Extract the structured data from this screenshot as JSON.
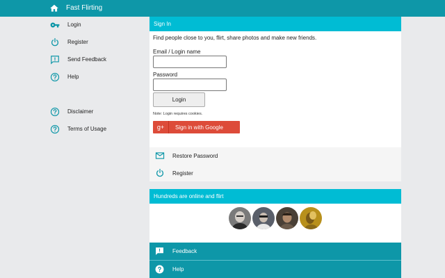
{
  "app": {
    "title": "Fast Flirting"
  },
  "sidebar": {
    "items": [
      {
        "label": "Login",
        "icon": "key-icon"
      },
      {
        "label": "Register",
        "icon": "power-icon"
      },
      {
        "label": "Send Feedback",
        "icon": "feedback-icon"
      },
      {
        "label": "Help",
        "icon": "help-icon"
      },
      {
        "label": "Disclaimer",
        "icon": "help-icon"
      },
      {
        "label": "Terms of Usage",
        "icon": "help-icon"
      }
    ]
  },
  "signin": {
    "header": "Sign In",
    "intro": "Find people close to you, flirt, share photos and make new friends.",
    "email_label": "Email / Login name",
    "email_value": "",
    "password_label": "Password",
    "password_value": "",
    "login_button": "Login",
    "note": "Note: Login requires cookies.",
    "google_button": "Sign in with Google",
    "google_glyph": "g+"
  },
  "links": [
    {
      "label": "Restore Password",
      "icon": "mail-icon"
    },
    {
      "label": "Register",
      "icon": "power-icon"
    }
  ],
  "online": {
    "header": "Hundreds are online and flirt",
    "avatar_colors": [
      "#6d6d6d",
      "#5a5f6a",
      "#4a4036",
      "#b8901c"
    ]
  },
  "footer": [
    {
      "label": "Feedback",
      "icon": "feedback-icon"
    },
    {
      "label": "Help",
      "icon": "help-icon"
    }
  ],
  "colors": {
    "topbar": "#0e97a8",
    "section_header": "#00bcd4",
    "google": "#dd4b39",
    "icon": "#0e97a8"
  }
}
